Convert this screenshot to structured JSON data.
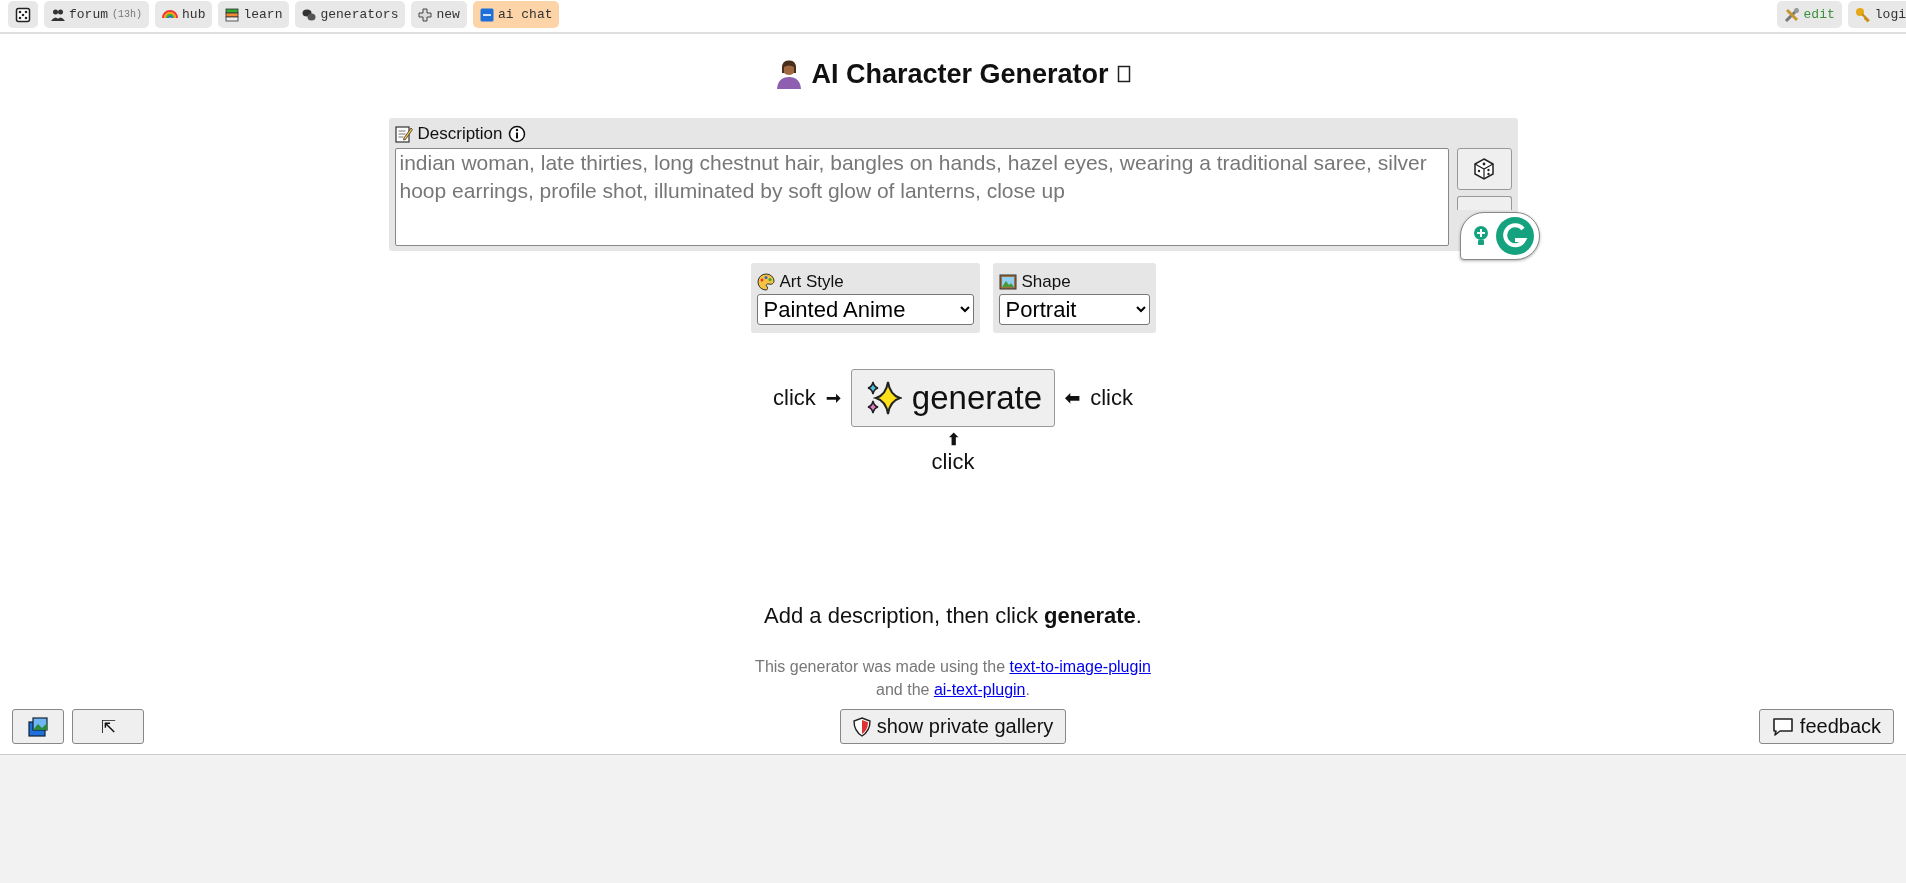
{
  "nav": {
    "left": [
      {
        "selected": false
      },
      {
        "label": "forum",
        "badge": "(13h)",
        "selected": false
      },
      {
        "label": "hub",
        "selected": false
      },
      {
        "label": "learn",
        "selected": false
      },
      {
        "label": "generators",
        "selected": false
      },
      {
        "label": "new",
        "selected": false
      },
      {
        "label": "ai chat",
        "selected": true
      }
    ],
    "right": [
      {
        "label": "edit",
        "color": "#3c8f3c"
      },
      {
        "label": "logi",
        "color": "#333333"
      }
    ]
  },
  "title": "AI Character Generator",
  "description": {
    "label": "Description",
    "placeholder": "indian woman, late thirties, long chestnut hair, bangles on hands, hazel eyes, wearing a traditional saree, silver hoop earrings, profile shot, illuminated by soft glow of lanterns, close up"
  },
  "selects": [
    {
      "label": "Art Style",
      "value": "Painted Anime"
    },
    {
      "label": "Shape",
      "value": "Portrait"
    }
  ],
  "generate": {
    "label": "generate",
    "hint_left": "click",
    "arrow_left": "➞",
    "hint_right": "click",
    "arrow_right": "⬅",
    "arrow_up": "⬆",
    "hint_below": "click"
  },
  "message": "Add a description, then click **generate**.",
  "credits": {
    "before": "This generator was made using the",
    "link_1": "text-to-image-plugin",
    "middle": "and the",
    "link_2": "ai-text-plugin",
    "after": "."
  },
  "bottom": {
    "scroll_top": "⇱",
    "gallery": "show private gallery",
    "feedback": "feedback"
  }
}
